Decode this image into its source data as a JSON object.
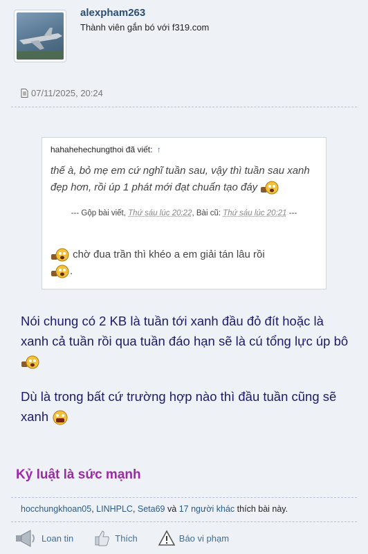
{
  "user": {
    "name": "alexpham263",
    "title": "Thành viên gắn bó với f319.com"
  },
  "post": {
    "date": "07/11/2025, 20:24"
  },
  "quote": {
    "author": "hahahehechungthoi đã viết:",
    "arrow": "↑",
    "text": "thế à, bỏ mẹ em cứ nghĩ tuần sau, vậy thì tuần sau xanh đẹp hơn, rồi úp 1 phát mới đạt chuẩn tạo đáy",
    "merge": {
      "prefix": "--- Gộp bài viết,",
      "time1": "Thứ sáu lúc 20:22",
      "old_label": "Bài cũ:",
      "time2": "Thứ sáu lúc 20:21",
      "suffix": "---"
    },
    "tail_text": "chờ đua trần thì khéo a em giải tán lâu rồi",
    "tail_end": "."
  },
  "body": {
    "para1": "Nói chung có 2 KB là tuần tới xanh đầu đỏ đít hoặc là xanh cả tuần rồi qua tuần đáo hạn sẽ là cú tổng lực úp bô",
    "para2": "Dù là trong bất cứ trường hợp nào thì đầu tuần cũng sẽ xanh"
  },
  "signature": "Kỷ luật là sức mạnh",
  "likes": {
    "users": [
      "hocchungkhoan05",
      "LINHPLC",
      "Seta69"
    ],
    "and": "và",
    "others": "17 người khác",
    "suffix": "thích bài này."
  },
  "actions": {
    "share": "Loan tin",
    "like": "Thích",
    "report": "Báo vi phạm"
  },
  "colors": {
    "background": "#eef1f6",
    "username": "#2b4e73",
    "body_text": "#1b1b6b",
    "signature": "#9b2aa5",
    "link": "#3d6e9c"
  },
  "icons": [
    "document-icon",
    "smiley-icon",
    "speaker-icon",
    "thumbs-up-icon",
    "warning-icon"
  ]
}
